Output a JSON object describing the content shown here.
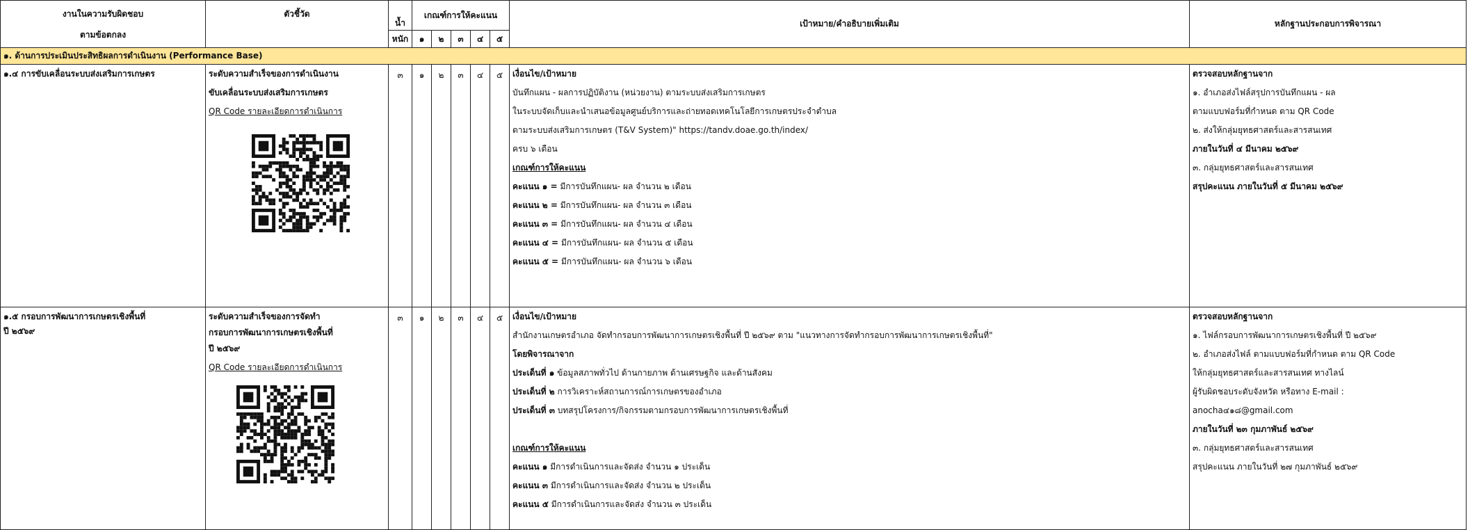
{
  "header": {
    "col_responsibility_l1": "งานในความรับผิดชอบ",
    "col_responsibility_l2": "ตามข้อตกลง",
    "col_indicator": "ตัวชี้วัด",
    "col_weight_l1": "น้ำ",
    "col_weight_l2": "หนัก",
    "col_criteria": "เกณฑ์การให้คะแนน",
    "criteria_levels": [
      "๑",
      "๒",
      "๓",
      "๔",
      "๕"
    ],
    "col_target": "เป้าหมาย/คำอธิบายเพิ่มเติม",
    "col_evidence": "หลักฐานประกอบการพิจารณา"
  },
  "section": {
    "title": "๑. ด้านการประเมินประสิทธิผลการดำเนินงาน (Performance Base)"
  },
  "rows": [
    {
      "responsibility": "๑.๔ การขับเคลื่อนระบบส่งเสริมการเกษตร",
      "indicator_l1": "ระดับความสำเร็จของการดำเนินงาน",
      "indicator_l2": "ขับเคลื่อนระบบส่งเสริมการเกษตร",
      "qr_label": "QR Code รายละเอียดการดำเนินการ",
      "weight": "๓",
      "levels": [
        "๑",
        "๒",
        "๓",
        "๔",
        "๕"
      ],
      "target_lines": [
        {
          "text": "เงื่อนไข/เป้าหมาย",
          "style": "b"
        },
        {
          "text": "บันทึกแผน - ผลการปฏิบัติงาน (หน่วยงาน) ตามระบบส่งเสริมการเกษตร",
          "style": ""
        },
        {
          "text": "ในระบบจัดเก็บและนำเสนอข้อมูลศูนย์บริการและถ่ายทอดเทคโนโลยีการเกษตรประจำตำบล",
          "style": ""
        },
        {
          "text": "ตามระบบส่งเสริมการเกษตร (T&V System)\" https://tandv.doae.go.th/index/",
          "style": ""
        },
        {
          "text": "ครบ ๖ เดือน",
          "style": ""
        },
        {
          "text": "เกณฑ์การให้คะแนน",
          "style": "bu"
        }
      ],
      "scores": [
        {
          "label": "คะแนน ๑ =",
          "text": "มีการบันทึกแผน- ผล จำนวน ๒ เดือน"
        },
        {
          "label": "คะแนน ๒ =",
          "text": "มีการบันทึกแผน- ผล จำนวน ๓ เดือน"
        },
        {
          "label": "คะแนน ๓ =",
          "text": "มีการบันทึกแผน- ผล จำนวน ๔ เดือน"
        },
        {
          "label": "คะแนน ๔ =",
          "text": "มีการบันทึกแผน- ผล จำนวน ๕ เดือน"
        },
        {
          "label": "คะแนน ๕ =",
          "text": "มีการบันทึกแผน- ผล จำนวน ๖ เดือน"
        }
      ],
      "evidence_lines": [
        {
          "text": "ตรวจสอบหลักฐานจาก",
          "style": "b"
        },
        {
          "text": "๑. อำเภอส่งไฟล์สรุปการบันทึกแผน - ผล",
          "style": ""
        },
        {
          "text": "ตามแบบฟอร์มที่กำหนด ตาม QR Code",
          "style": ""
        },
        {
          "text": "๒. ส่งให้กลุ่มยุทธศาสตร์และสารสนเทศ",
          "style": ""
        },
        {
          "text": "ภายในวันที่ ๔ มีนาคม ๒๕๖๙",
          "style": "b"
        },
        {
          "text": "๓. กลุ่มยุทธศาสตร์และสารสนเทศ",
          "style": ""
        },
        {
          "text": "สรุปคะแนน ภายในวันที่ ๕ มีนาคม ๒๕๖๙",
          "style": "b"
        }
      ]
    },
    {
      "responsibility_l1": "๑.๕ กรอบการพัฒนาการเกษตรเชิงพื้นที่",
      "responsibility_l2": "ปี ๒๕๖๙",
      "indicator_l1": "ระดับความสำเร็จของการจัดทำ",
      "indicator_l2": "กรอบการพัฒนาการเกษตรเชิงพื้นที่",
      "indicator_l3": "ปี ๒๕๖๙",
      "qr_label": "QR Code รายละเอียดการดำเนินการ",
      "weight": "๓",
      "levels": [
        "๑",
        "๒",
        "๓",
        "๔",
        "๕"
      ],
      "target_title": "เงื่อนไข/เป้าหมาย",
      "target_desc": "สำนักงานเกษตรอำเภอ จัดทำกรอบการพัฒนาการเกษตรเชิงพื้นที่ ปี ๒๕๖๙ ตาม \"แนวทางการจัดทำกรอบการพัฒนาการเกษตรเชิงพื้นที่\"",
      "consider_title": "โดยพิจารณาจาก",
      "issues": [
        {
          "label": "ประเด็นที่ ๑",
          "text": "ข้อมูลสภาพทั่วไป ด้านกายภาพ ด้านเศรษฐกิจ และด้านสังคม"
        },
        {
          "label": "ประเด็นที่ ๒",
          "text": "การวิเคราะห์สถานการณ์การเกษตรของอำเภอ"
        },
        {
          "label": "ประเด็นที่ ๓",
          "text": "บทสรุปโครงการ/กิจกรรมตามกรอบการพัฒนาการเกษตรเชิงพื้นที่"
        }
      ],
      "criteria_title": "เกณฑ์การให้คะแนน",
      "scores": [
        {
          "label": "คะแนน ๑",
          "text": "มีการดำเนินการและจัดส่ง จำนวน ๑ ประเด็น"
        },
        {
          "label": "คะแนน ๓",
          "text": "มีการดำเนินการและจัดส่ง จำนวน ๒ ประเด็น"
        },
        {
          "label": "คะแนน ๕",
          "text": "มีการดำเนินการและจัดส่ง จำนวน ๓ ประเด็น"
        }
      ],
      "evidence_lines": [
        {
          "text": "ตรวจสอบหลักฐานจาก",
          "style": "b"
        },
        {
          "text": "๑. ไฟล์กรอบการพัฒนาการเกษตรเชิงพื้นที่ ปี ๒๕๖๙",
          "style": ""
        },
        {
          "text": "๒. อำเภอส่งไฟล์ ตามแบบฟอร์มที่กำหนด ตาม QR Code",
          "style": ""
        },
        {
          "text": "ให้กลุ่มยุทธศาสตร์และสารสนเทศ ทางไลน์",
          "style": ""
        },
        {
          "text": "ผู้รับผิดชอบระดับจังหวัด หรือทาง E-mail :",
          "style": ""
        },
        {
          "text": " anocha๔๑๘@gmail.com",
          "style": ""
        },
        {
          "text": " ภายในวันที่ ๒๓ กุมภาพันธ์ ๒๕๖๙",
          "style": "b"
        },
        {
          "text": "๓. กลุ่มยุทธศาสตร์และสารสนเทศ",
          "style": ""
        },
        {
          "text": "สรุปคะแนน ภายในวันที่ ๒๗ กุมภาพันธ์ ๒๕๖๙",
          "style": ""
        }
      ]
    }
  ]
}
